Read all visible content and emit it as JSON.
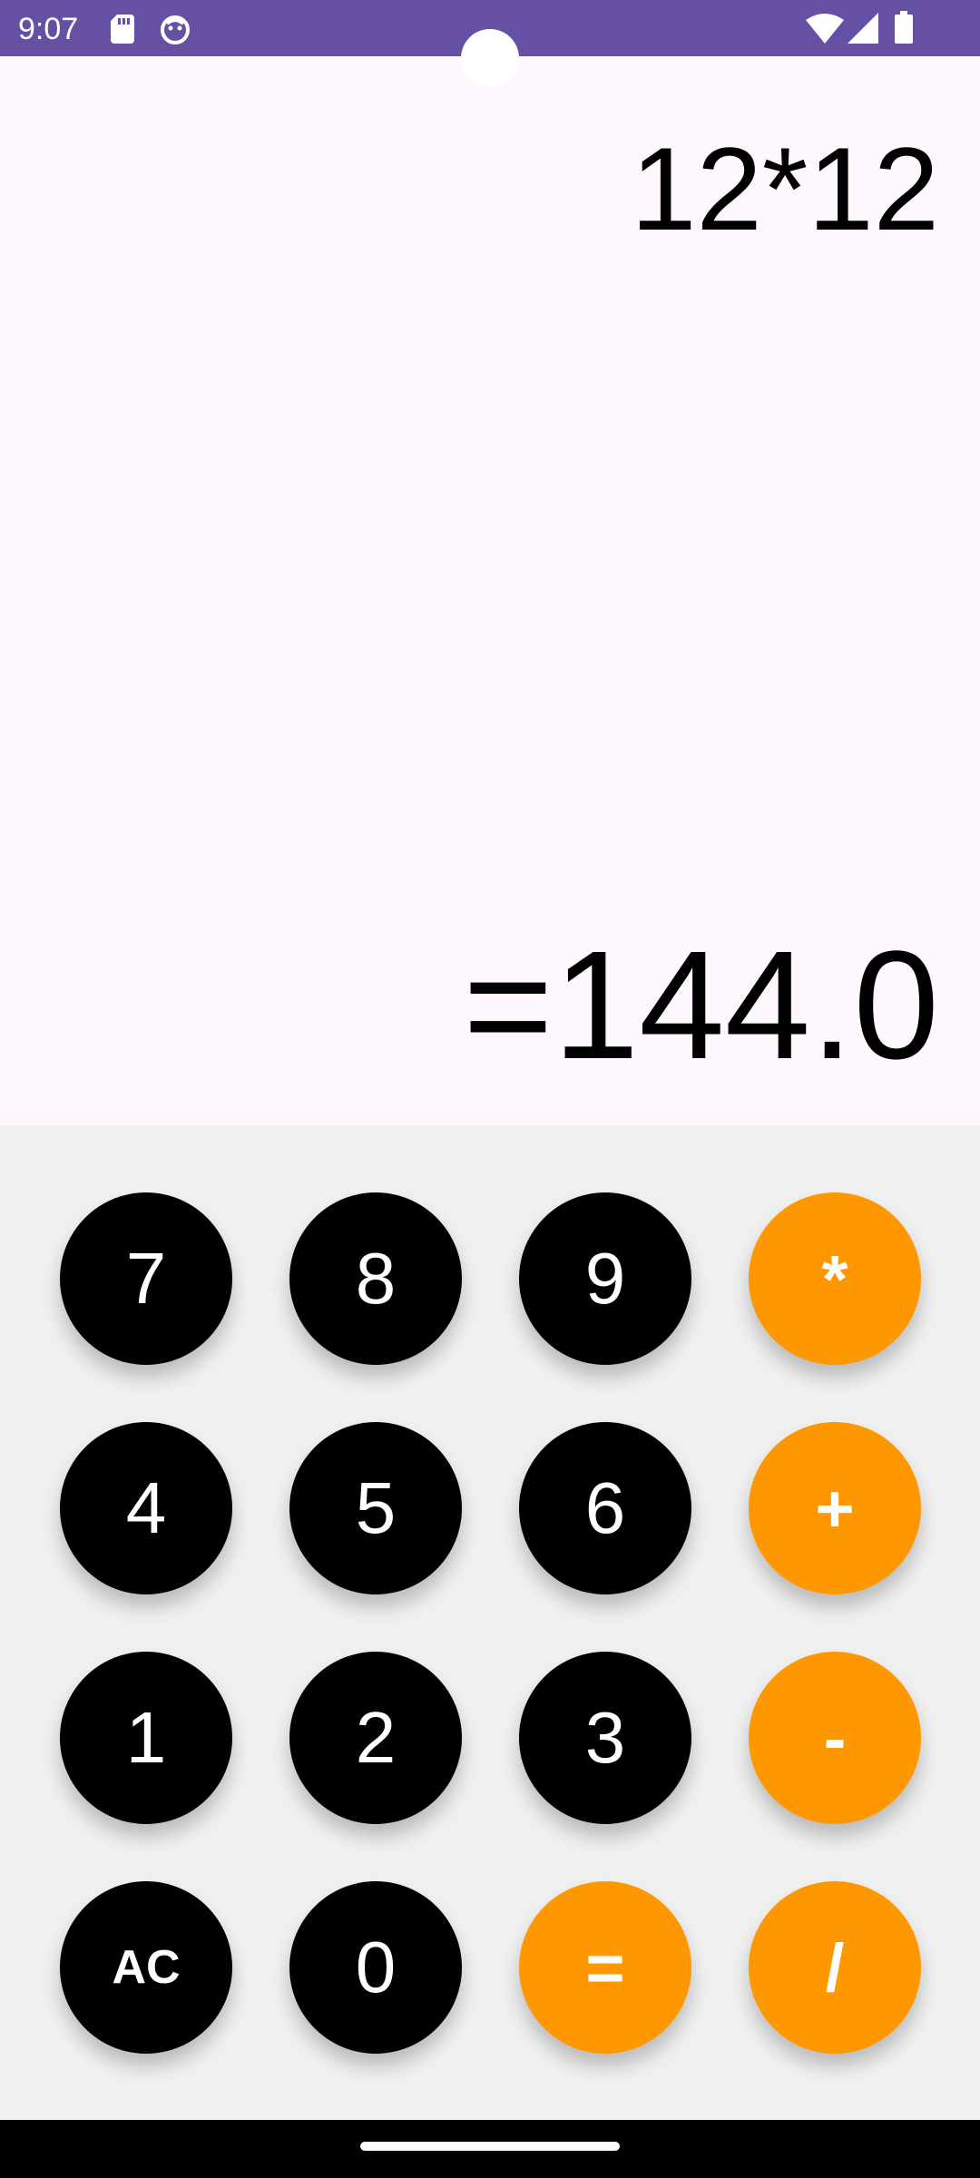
{
  "status_bar": {
    "time": "9:07",
    "background": "#6650a4",
    "icons": [
      "sd-card-icon",
      "face-icon",
      "wifi-icon",
      "signal-icon",
      "battery-icon"
    ]
  },
  "display": {
    "expression": "12*12",
    "result": "=144.0"
  },
  "keypad": {
    "keys": {
      "seven": "7",
      "eight": "8",
      "nine": "9",
      "multiply": "*",
      "four": "4",
      "five": "5",
      "six": "6",
      "add": "+",
      "one": "1",
      "two": "2",
      "three": "3",
      "subtract": "-",
      "clear": "AC",
      "zero": "0",
      "equals": "=",
      "divide": "/"
    }
  },
  "colors": {
    "accent": "#ff9800",
    "number_key": "#000000",
    "display_bg": "#fef7fd",
    "keypad_bg": "#f0f0f0"
  }
}
